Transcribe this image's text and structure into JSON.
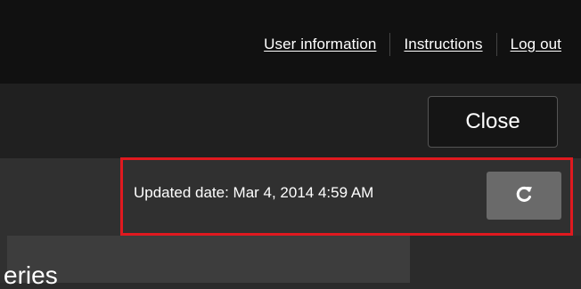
{
  "header": {
    "nav": [
      {
        "label": "User information"
      },
      {
        "label": "Instructions"
      },
      {
        "label": "Log out"
      }
    ]
  },
  "toolbar": {
    "close_label": "Close"
  },
  "update": {
    "text": "Updated date: Mar 4, 2014 4:59 AM",
    "refresh_icon": "refresh-icon",
    "highlight_color": "#e0191f"
  },
  "content": {
    "partial_text": "eries"
  }
}
